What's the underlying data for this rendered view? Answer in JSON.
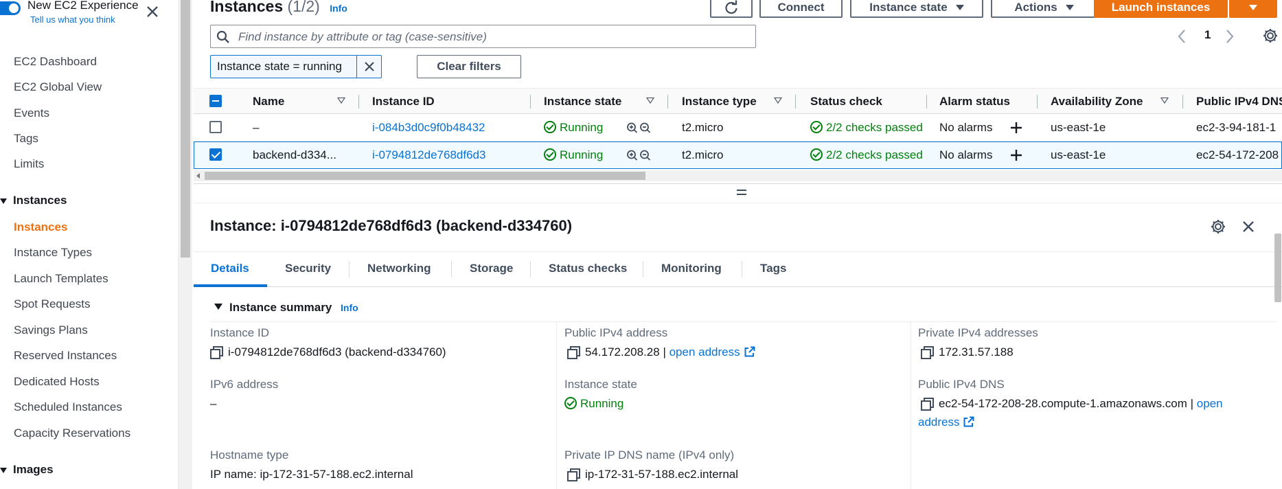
{
  "experience": {
    "title": "New EC2 Experience",
    "subtitle": "Tell us what you think"
  },
  "sidebar": {
    "items": [
      {
        "label": "EC2 Dashboard"
      },
      {
        "label": "EC2 Global View"
      },
      {
        "label": "Events"
      },
      {
        "label": "Tags"
      },
      {
        "label": "Limits"
      }
    ],
    "instances_section": "Instances",
    "instances_items": [
      {
        "label": "Instances",
        "active": true
      },
      {
        "label": "Instance Types"
      },
      {
        "label": "Launch Templates"
      },
      {
        "label": "Spot Requests"
      },
      {
        "label": "Savings Plans"
      },
      {
        "label": "Reserved Instances"
      },
      {
        "label": "Dedicated Hosts"
      },
      {
        "label": "Scheduled Instances"
      },
      {
        "label": "Capacity Reservations"
      }
    ],
    "images_section": "Images"
  },
  "header": {
    "title": "Instances",
    "count": "(1/2)",
    "info": "Info",
    "buttons": {
      "connect": "Connect",
      "instance_state": "Instance state",
      "actions": "Actions",
      "launch": "Launch instances"
    }
  },
  "search": {
    "placeholder": "Find instance by attribute or tag (case-sensitive)"
  },
  "pagination": {
    "page": "1"
  },
  "filter": {
    "chip": "Instance state = running",
    "clear": "Clear filters"
  },
  "table": {
    "columns": [
      "Name",
      "Instance ID",
      "Instance state",
      "Instance type",
      "Status check",
      "Alarm status",
      "Availability Zone",
      "Public IPv4 DNS"
    ],
    "rows": [
      {
        "name": "–",
        "id": "i-084b3d0c9f0b48432",
        "state": "Running",
        "type": "t2.micro",
        "status": "2/2 checks passed",
        "alarm": "No alarms",
        "az": "us-east-1e",
        "dns": "ec2-3-94-181-1",
        "selected": false
      },
      {
        "name": "backend-d334...",
        "id": "i-0794812de768df6d3",
        "state": "Running",
        "type": "t2.micro",
        "status": "2/2 checks passed",
        "alarm": "No alarms",
        "az": "us-east-1e",
        "dns": "ec2-54-172-208",
        "selected": true
      }
    ]
  },
  "details": {
    "title": "Instance: i-0794812de768df6d3 (backend-d334760)",
    "tabs": [
      "Details",
      "Security",
      "Networking",
      "Storage",
      "Status checks",
      "Monitoring",
      "Tags"
    ],
    "summary_title": "Instance summary",
    "summary_info": "Info",
    "fields": {
      "instance_id_label": "Instance ID",
      "instance_id_value": "i-0794812de768df6d3 (backend-d334760)",
      "public_ip_label": "Public IPv4 address",
      "public_ip_value": "54.172.208.28 |",
      "open_address": "open address",
      "private_ip_label": "Private IPv4 addresses",
      "private_ip_value": "172.31.57.188",
      "ipv6_label": "IPv6 address",
      "ipv6_value": "–",
      "state_label": "Instance state",
      "state_value": "Running",
      "public_dns_label": "Public IPv4 DNS",
      "public_dns_value": "ec2-54-172-208-28.compute-1.amazonaws.com |",
      "public_dns_open_1": "open",
      "public_dns_open_2": "address",
      "hostname_label": "Hostname type",
      "hostname_value": "IP name: ip-172-31-57-188.ec2.internal",
      "private_dns_label": "Private IP DNS name (IPv4 only)",
      "private_dns_value": "ip-172-31-57-188.ec2.internal"
    }
  },
  "colors": {
    "accent": "#0972d3",
    "primary": "#ec7211",
    "success": "#037f0c"
  }
}
